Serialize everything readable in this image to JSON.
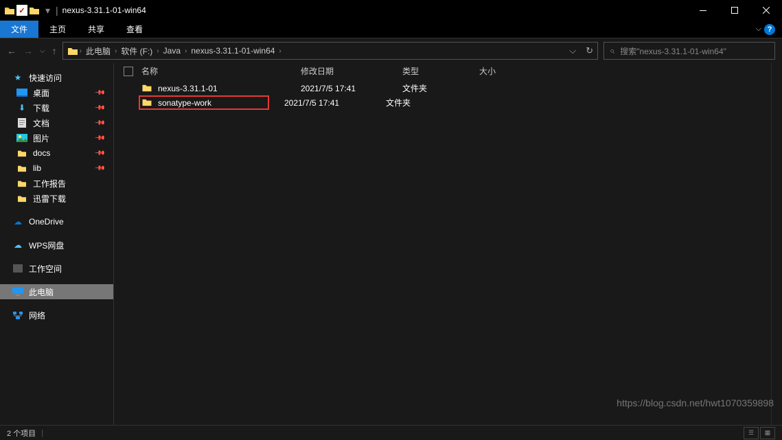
{
  "title": "nexus-3.31.1-01-win64",
  "ribbon": {
    "file": "文件",
    "home": "主页",
    "share": "共享",
    "view": "查看"
  },
  "breadcrumbs": [
    "此电脑",
    "软件 (F:)",
    "Java",
    "nexus-3.31.1-01-win64"
  ],
  "search_placeholder": "搜索\"nexus-3.31.1-01-win64\"",
  "columns": {
    "name": "名称",
    "modified": "修改日期",
    "type": "类型",
    "size": "大小"
  },
  "sidebar": {
    "quick_access": "快速访问",
    "items": [
      {
        "label": "桌面",
        "icon": "desktop",
        "pinned": true
      },
      {
        "label": "下载",
        "icon": "download",
        "pinned": true
      },
      {
        "label": "文档",
        "icon": "document",
        "pinned": true
      },
      {
        "label": "图片",
        "icon": "pictures",
        "pinned": true
      },
      {
        "label": "docs",
        "icon": "folder",
        "pinned": true
      },
      {
        "label": "lib",
        "icon": "folder",
        "pinned": true
      },
      {
        "label": "工作报告",
        "icon": "folder",
        "pinned": false
      },
      {
        "label": "迅雷下载",
        "icon": "folder",
        "pinned": false
      }
    ],
    "onedrive": "OneDrive",
    "wps": "WPS网盘",
    "workspace": "工作空间",
    "this_pc": "此电脑",
    "network": "网络"
  },
  "files": [
    {
      "name": "nexus-3.31.1-01",
      "modified": "2021/7/5 17:41",
      "type": "文件夹",
      "highlight": false
    },
    {
      "name": "sonatype-work",
      "modified": "2021/7/5 17:41",
      "type": "文件夹",
      "highlight": true
    }
  ],
  "status": "2 个项目",
  "watermark": "https://blog.csdn.net/hwt1070359898"
}
